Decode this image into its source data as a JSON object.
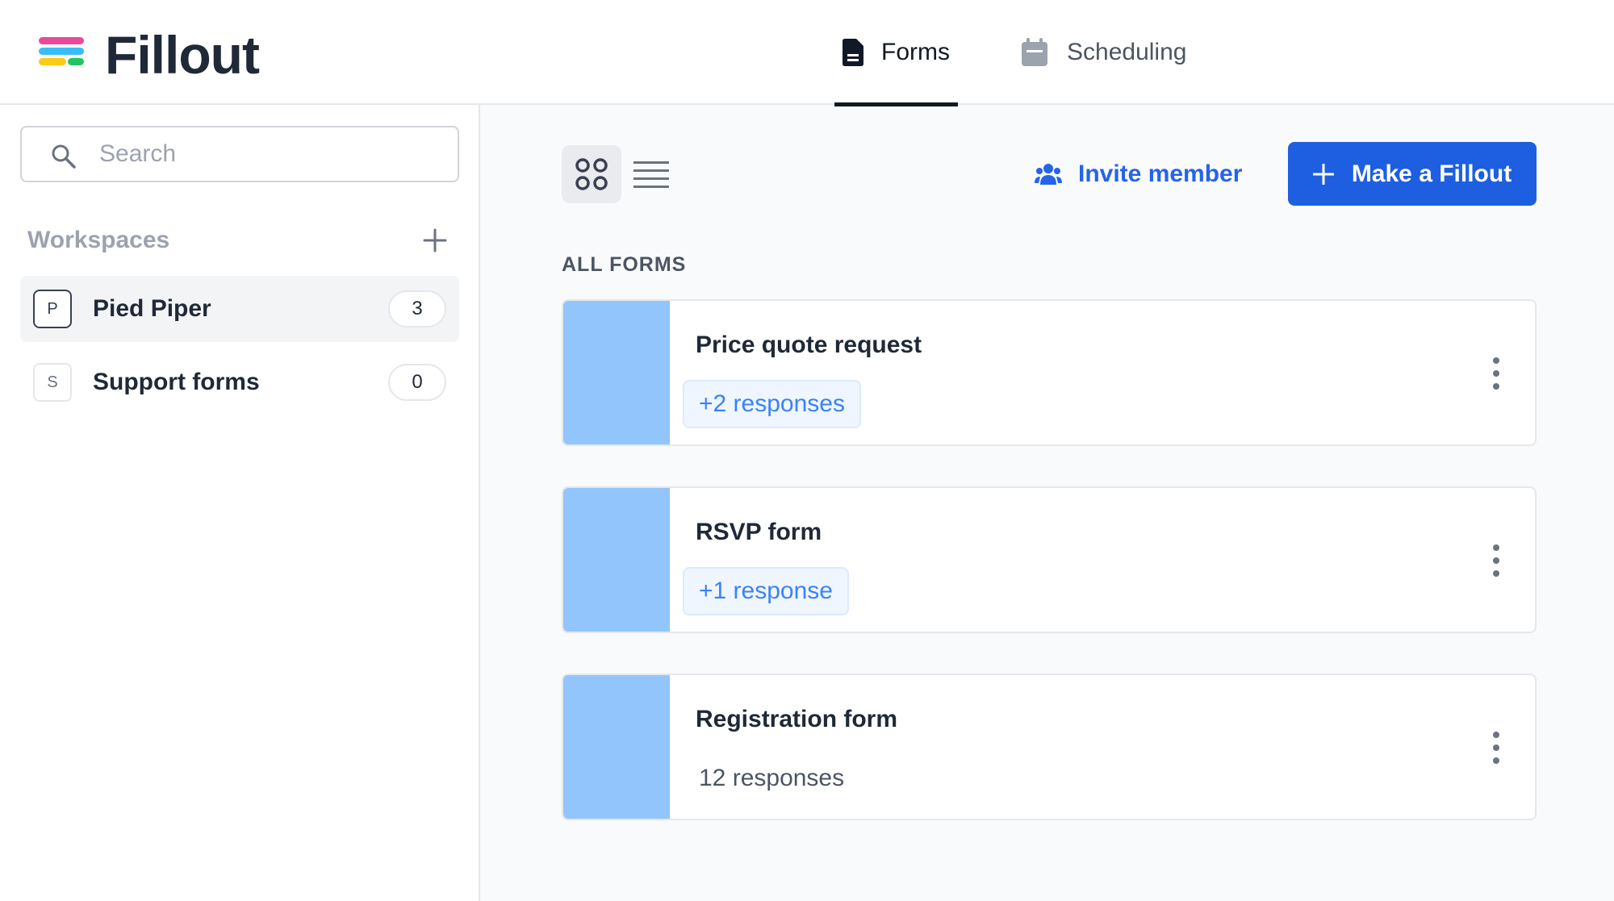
{
  "app": {
    "name": "Fillout",
    "logo_colors": [
      "#ec4899",
      "#3b82f6",
      "#facc15",
      "#22c55e"
    ]
  },
  "nav": {
    "tabs": [
      {
        "label": "Forms",
        "icon": "document-icon",
        "active": true
      },
      {
        "label": "Scheduling",
        "icon": "calendar-icon",
        "active": false
      }
    ]
  },
  "sidebar": {
    "search": {
      "placeholder": "Search",
      "value": ""
    },
    "workspaces_title": "Workspaces",
    "workspaces": [
      {
        "initial": "P",
        "name": "Pied Piper",
        "count": "3",
        "selected": true
      },
      {
        "initial": "S",
        "name": "Support forms",
        "count": "0",
        "selected": false
      }
    ]
  },
  "toolbar": {
    "view_mode": "grid",
    "invite_label": "Invite member",
    "make_label": "Make a Fillout"
  },
  "forms": {
    "section_label": "ALL FORMS",
    "items": [
      {
        "title": "Price quote request",
        "responses": "+2 responses",
        "new": true
      },
      {
        "title": "RSVP form",
        "responses": "+1 response",
        "new": true
      },
      {
        "title": "Registration form",
        "responses": "12 responses",
        "new": false
      }
    ]
  },
  "colors": {
    "primary": "#1d5fe0",
    "link": "#2563eb",
    "thumb": "#93c5fd",
    "badge_text": "#3b82f6"
  }
}
